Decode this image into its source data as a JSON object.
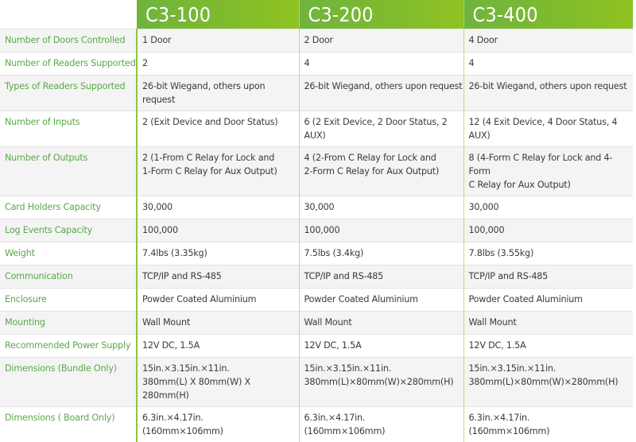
{
  "header": {
    "models": [
      "C3-100",
      "C3-200",
      "C3-400"
    ]
  },
  "colors": {
    "header_green": "#7dba2f",
    "label_green": "#5aa84a",
    "row_gray": "#f4f4f4"
  },
  "rows": [
    {
      "label": "Number of Doors Controlled",
      "values": [
        "1 Door",
        "2 Door",
        "4 Door"
      ]
    },
    {
      "label": "Number of Readers Supported",
      "values": [
        "2",
        "4",
        "4"
      ]
    },
    {
      "label": "Types of Readers Supported",
      "values": [
        "26-bit Wiegand, others upon request",
        "26-bit Wiegand, others upon request",
        "26-bit Wiegand, others upon request"
      ]
    },
    {
      "label": "Number of Inputs",
      "values": [
        "2 (Exit Device and Door Status)",
        "6 (2 Exit Device, 2 Door Status, 2 AUX)",
        "12 (4 Exit Device, 4 Door Status, 4 AUX)"
      ]
    },
    {
      "label": "Number of Outputs",
      "values": [
        [
          "2 (1-From C Relay for Lock and",
          "1-Form C Relay for Aux Output)"
        ],
        [
          "4 (2-From C Relay for Lock and",
          "2-Form C Relay for Aux Output)"
        ],
        [
          "8 (4-Form C Relay for Lock and 4-Form",
          "C Relay for Aux Output)"
        ]
      ]
    },
    {
      "label": "Card Holders Capacity",
      "values": [
        "30,000",
        "30,000",
        "30,000"
      ]
    },
    {
      "label": "Log Events Capacity",
      "values": [
        "100,000",
        "100,000",
        "100,000"
      ]
    },
    {
      "label": "Weight",
      "values": [
        "7.4lbs (3.35kg)",
        "7.5lbs (3.4kg)",
        "7.8lbs (3.55kg)"
      ]
    },
    {
      "label": "Communication",
      "values": [
        "TCP/IP and RS-485",
        "TCP/IP and RS-485",
        "TCP/IP and RS-485"
      ]
    },
    {
      "label": "Enclosure",
      "values": [
        "Powder Coated Aluminium",
        "Powder Coated Aluminium",
        "Powder Coated Aluminium"
      ]
    },
    {
      "label": "Mounting",
      "values": [
        "Wall Mount",
        "Wall Mount",
        "Wall Mount"
      ]
    },
    {
      "label": "Recommended Power Supply",
      "values": [
        "12V DC, 1.5A",
        "12V DC, 1.5A",
        "12V DC, 1.5A"
      ]
    },
    {
      "label": "Dimensions (Bundle Only)",
      "values": [
        [
          "15in.×3.15in.×11in.",
          "380mm(L) X 80mm(W) X 280mm(H)"
        ],
        [
          "15in.×3.15in.×11in.",
          "380mm(L)×80mm(W)×280mm(H)"
        ],
        [
          "15in.×3.15in.×11in.",
          "380mm(L)×80mm(W)×280mm(H)"
        ]
      ]
    },
    {
      "label": "Dimensions ( Board Only)",
      "values": [
        [
          "6.3in.×4.17in.",
          "(160mm×106mm)"
        ],
        [
          "6.3in.×4.17in.",
          "(160mm×106mm)"
        ],
        [
          "6.3in.×4.17in.",
          "(160mm×106mm)"
        ]
      ]
    }
  ]
}
